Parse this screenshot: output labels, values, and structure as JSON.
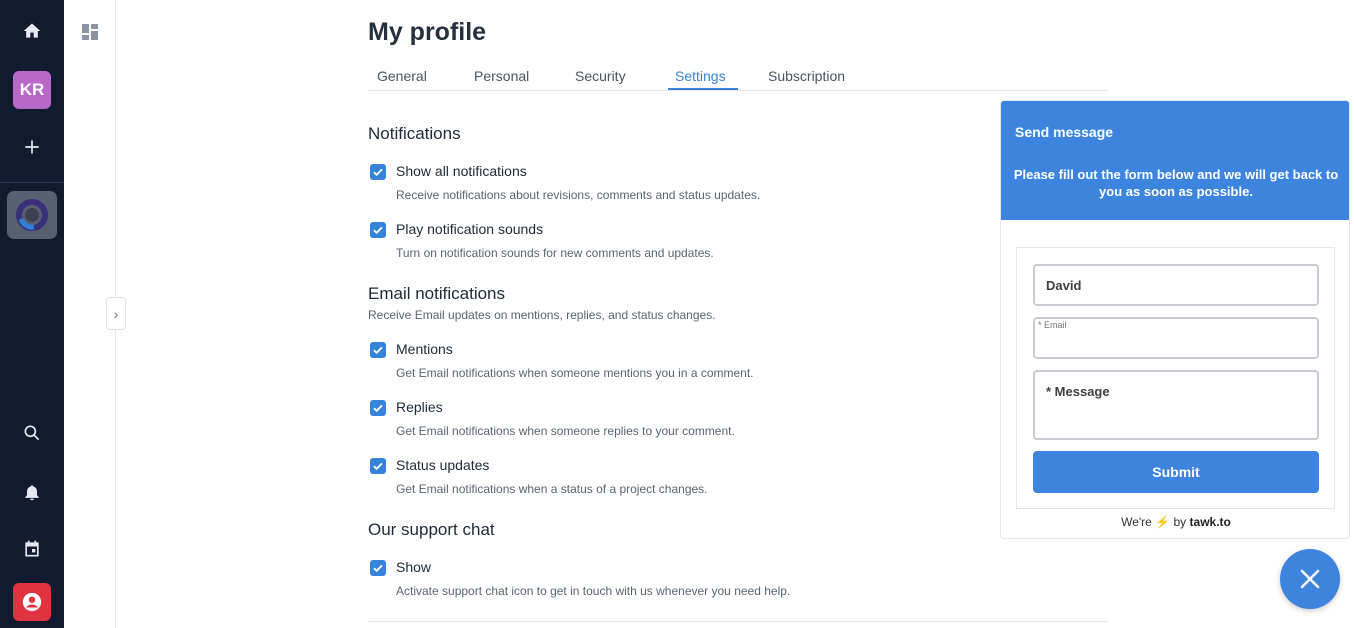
{
  "rail": {
    "avatar_initials": "KR",
    "avatar_color": "#b868c7",
    "icons": [
      "home-icon",
      "plus-icon",
      "workspace-icon",
      "search-icon",
      "bell-icon",
      "calendar-icon",
      "user-circle-icon"
    ]
  },
  "page": {
    "title": "My profile",
    "tabs": [
      {
        "label": "General"
      },
      {
        "label": "Personal"
      },
      {
        "label": "Security"
      },
      {
        "label": "Settings",
        "active": true
      },
      {
        "label": "Subscription"
      }
    ]
  },
  "sections": {
    "notifications": {
      "title": "Notifications",
      "options": [
        {
          "label": "Show all notifications",
          "desc": "Receive notifications about revisions, comments and status updates.",
          "checked": true
        },
        {
          "label": "Play notification sounds",
          "desc": "Turn on notification sounds for new comments and updates.",
          "checked": true
        }
      ]
    },
    "email": {
      "title": "Email notifications",
      "desc": "Receive Email updates on mentions, replies, and status changes.",
      "options": [
        {
          "label": "Mentions",
          "desc": "Get Email notifications when someone mentions you in a comment.",
          "checked": true
        },
        {
          "label": "Replies",
          "desc": "Get Email notifications when someone replies to your comment.",
          "checked": true
        },
        {
          "label": "Status updates",
          "desc": "Get Email notifications when a status of a project changes.",
          "checked": true
        }
      ]
    },
    "support": {
      "title": "Our support chat",
      "options": [
        {
          "label": "Show",
          "desc": "Activate support chat icon to get in touch with us whenever you need help.",
          "checked": true
        }
      ]
    }
  },
  "chat": {
    "title": "Send message",
    "subtitle": "Please fill out the form below and we will get back to you as soon as possible.",
    "name_value": "David",
    "email_placeholder": "* Email",
    "message_placeholder": "* Message",
    "submit_label": "Submit",
    "powered_prefix": "We're",
    "powered_by": "by",
    "powered_brand": "tawk.to",
    "accent": "#3d84de"
  },
  "colors": {
    "rail_bg": "#111a2e",
    "accent": "#3683dc",
    "user_button": "#e0323f"
  }
}
